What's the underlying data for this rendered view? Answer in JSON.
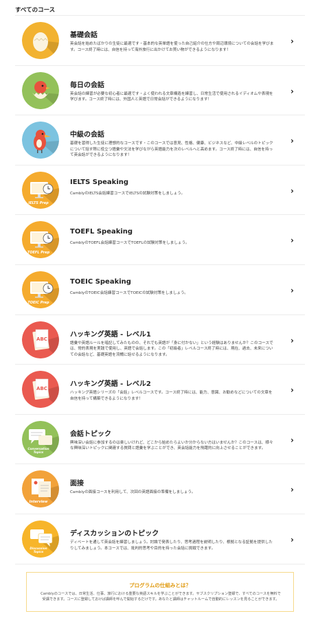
{
  "section_title": "すべてのコース",
  "courses": [
    {
      "title": "基礎会話",
      "desc": "英会話を始めたばかりの生徒に最適です・基本的な英単語を使った自己紹介の仕方や周辺環境についての会話を学びます。コース終了時には、自信を持って海外旅行に出かけてお買い物ができるようになります！",
      "icon": "egg-icon",
      "color": "#f2b230"
    },
    {
      "title": "毎日の会話",
      "desc": "英会話の練習が必要な初心者に最適です・よく使われる文章構造を練習し、日常生活で使用されるイディオムや表現を学びます。コース終了時には、外国人と英語で日常会話ができるようになります！",
      "icon": "hatching-bird-icon",
      "color": "#93c15a"
    },
    {
      "title": "中級の会話",
      "desc": "基礎を習得した生徒に理想的なコースです・このコースでは意見、性格、健康、ビジネスなど、中級レベルのトピックについて話す際に役立つ語彙や文法を学びながら英語能力を次のレベルへと高めます。コース終了時には、自信を持って英会話ができるようになります！",
      "icon": "bird-icon",
      "color": "#7cc3e0"
    },
    {
      "title": "IELTS Speaking",
      "desc": "CamblyのIELTS会話練習コースでIELTSの試験対策をしましょう。",
      "icon": "computer-clock-icon",
      "color": "#f5ab2e",
      "badge": "IELTS Prep"
    },
    {
      "title": "TOEFL Speaking",
      "desc": "CamblyのTOEFL会話練習コースでTOEFLの試験対策をしましょう。",
      "icon": "computer-clock-icon",
      "color": "#f5ab2e",
      "badge": "TOEFL Prep"
    },
    {
      "title": "TOEIC Speaking",
      "desc": "CamblyのTOEIC会話練習コースでTOEICの試験対策をしましょう。",
      "icon": "computer-clock-icon",
      "color": "#f5ab2e",
      "badge": "TOEIC Prep"
    },
    {
      "title": "ハッキング英語 - レベル1",
      "desc": "語彙や英語ルールを暗記してみたものの、それでも英語が「身に付かない」という経験はありませんか？このコースでは、常的表現を実践で使用し、英語で会話します。この「初級者」レベルコース終了時には、現在、過去、未来についての会話など、基礎英語を流暢に話せるようになります。",
      "icon": "abc-book-icon",
      "color": "#ea5a50"
    },
    {
      "title": "ハッキング英語 - レベル2",
      "desc": "ハッキング英語シリーズの「会話」レベルコースです。コース終了時には、能力、意図、お勧めなどについての文章を自信を持って構築できるようになります！",
      "icon": "abc-book-icon",
      "color": "#ea5a50"
    },
    {
      "title": "会話トピック",
      "desc": "興味深い会話に参加するのは楽しいけれど、どこから始めたらよいか分からない方はいませんか？このコースは、様々な興味深いトピックに関連する質問と語彙を学ぶことができ、英会話能力を飛躍的に向上させることができます。",
      "icon": "speech-bubbles-icon",
      "color": "#93c15a",
      "badge": "Conversation Topics"
    },
    {
      "title": "面接",
      "desc": "Camblyの面接コースを利用して、次回の英語面接の準備をしましょう。",
      "icon": "interview-documents-icon",
      "color": "#f2a23a",
      "badge": "Interview"
    },
    {
      "title": "ディスカッションのトピック",
      "desc": "ディベートを通して英会話を練習しましょう。討論で発表したり、思考過程を説明したり、根拠となる証拠を提供したりしてみましょう。本コースでは、批判的思考や目的を持った会話に挑戦できます。",
      "icon": "discussion-bubbles-icon",
      "color": "#f7b52a",
      "badge": "Discussion Topics"
    }
  ],
  "footer": {
    "title": "プログラムの仕組みとは？",
    "text": "Camblyのコースでは、日常生活、仕事、旅行における重要な英語スキルを学ぶことができます。サブスクリプション登録で、すべてのコースを無料で受講できます。コースに登録しておけば講師を呼んで開始するだけです。あなたと講師はチャットルームで自動的にレッスンを見ることができます。"
  },
  "chevron": "›"
}
